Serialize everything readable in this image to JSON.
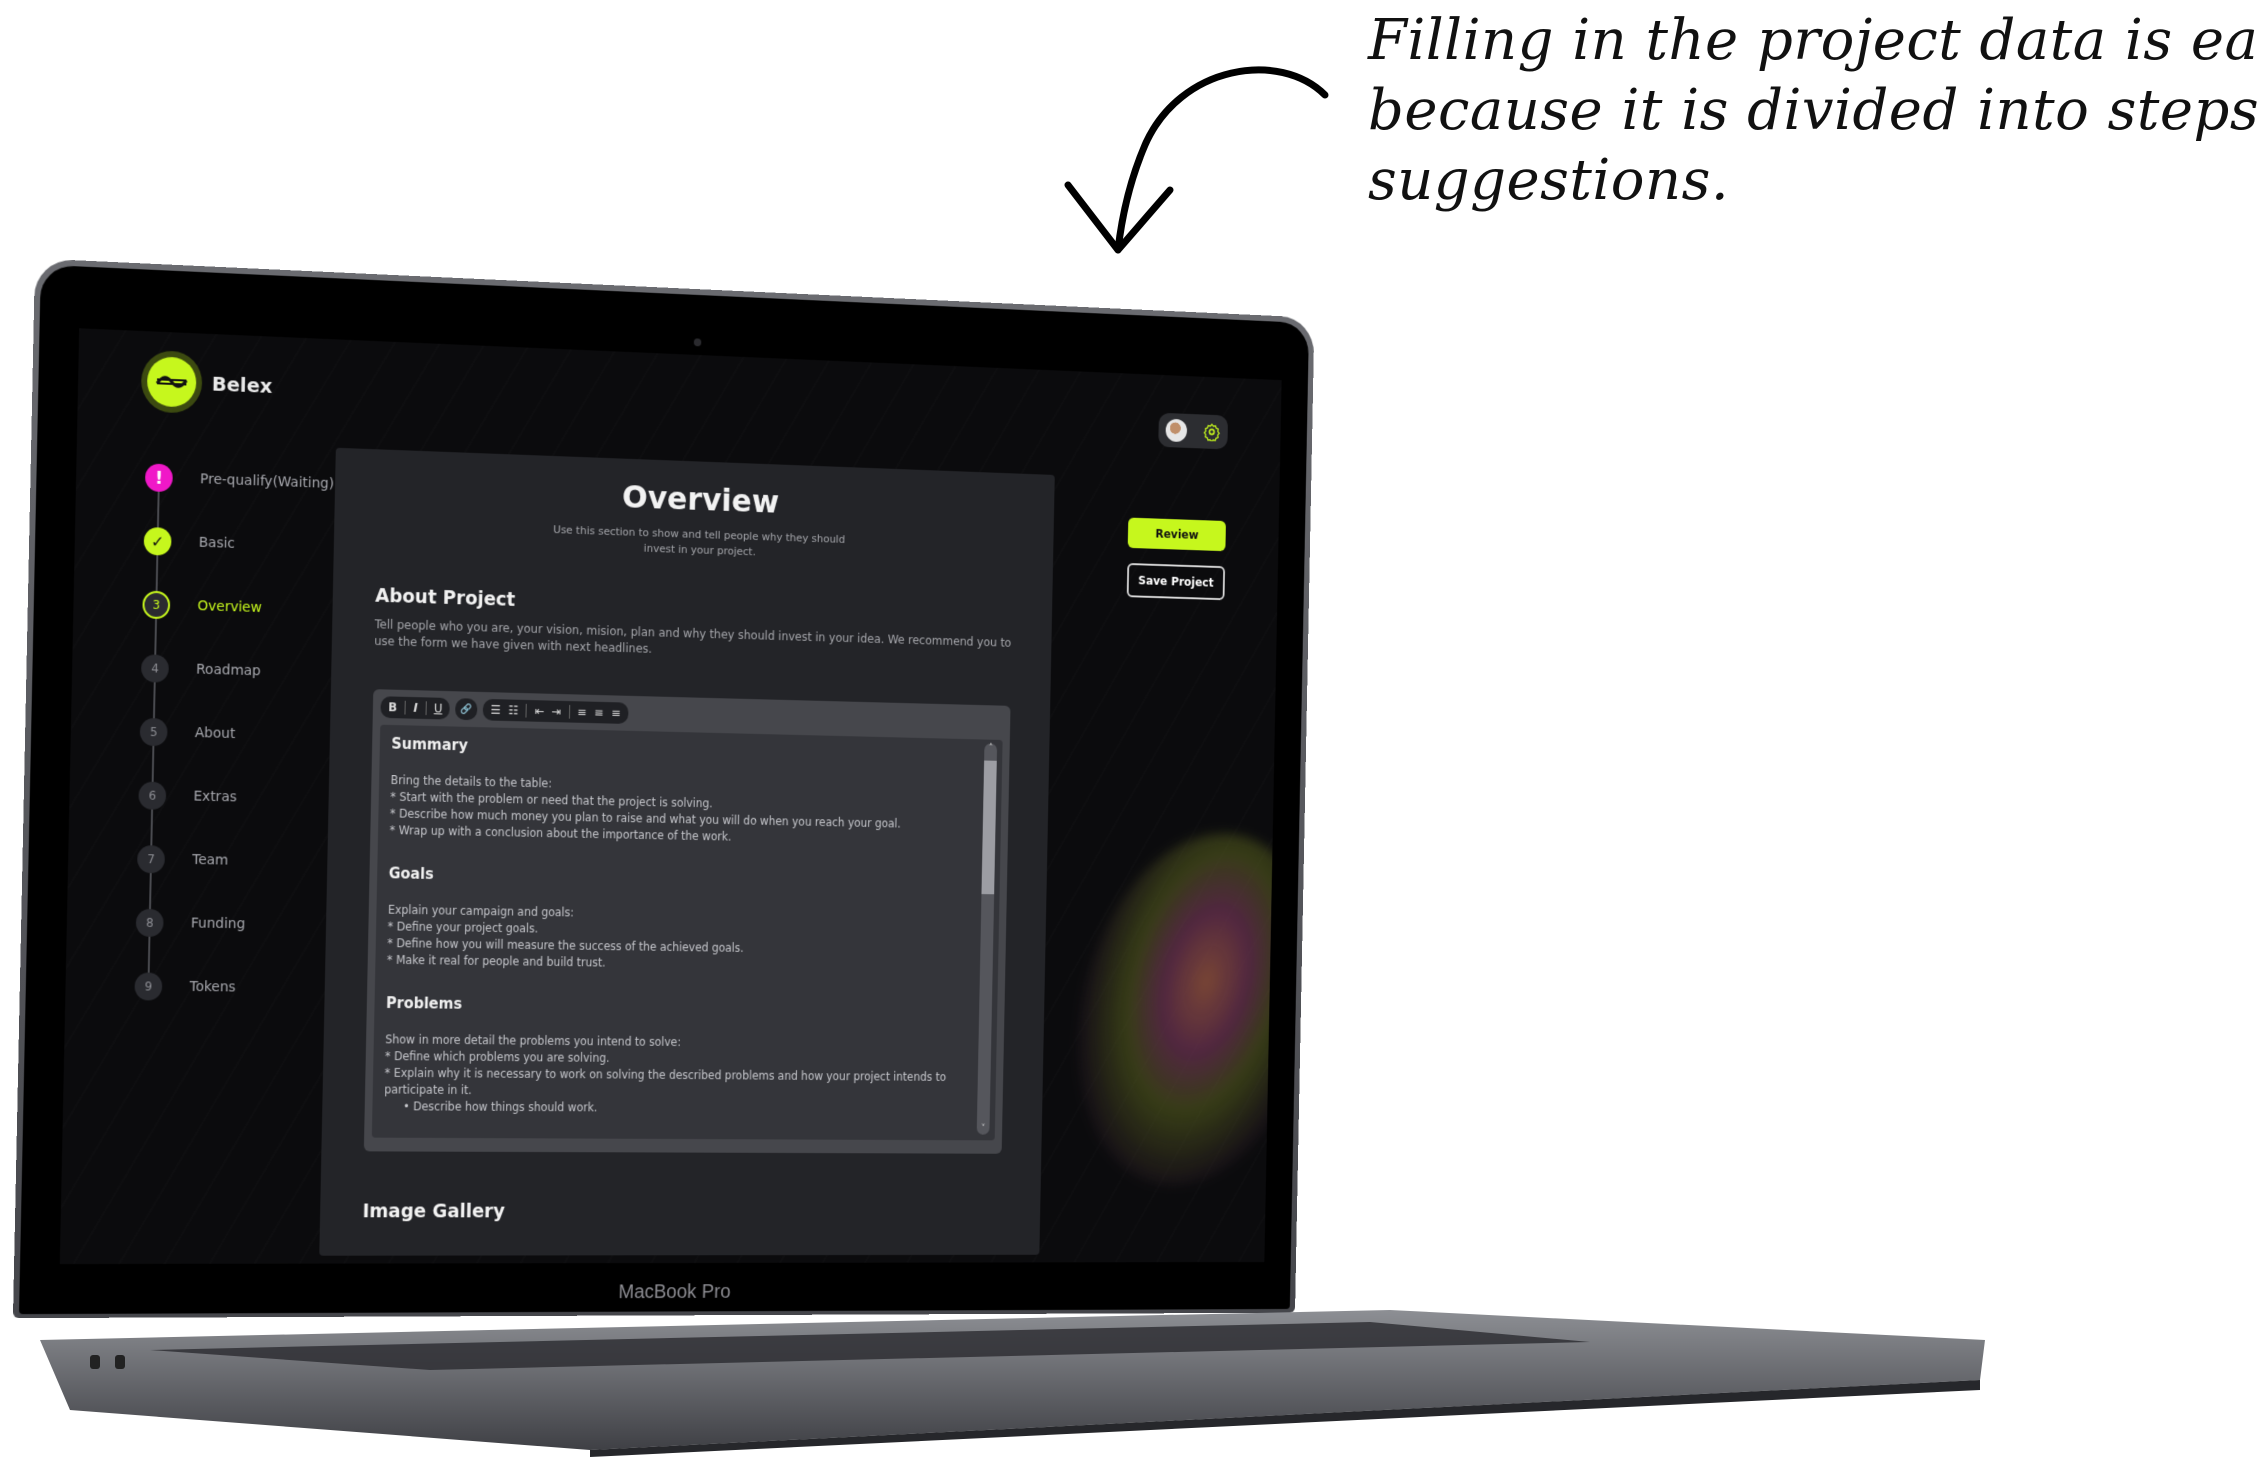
{
  "annotation": {
    "lines": [
      "Filling in the project data is easy",
      "because it is divided into steps with",
      "suggestions."
    ]
  },
  "device": {
    "label": "MacBook Pro"
  },
  "app": {
    "brand": "Belex",
    "accent_color": "#c6f71d",
    "warning_color": "#f018c8"
  },
  "steps": [
    {
      "marker": "!",
      "label": "Pre-qualify(Waiting)",
      "state": "warning"
    },
    {
      "marker": "✓",
      "label": "Basic",
      "state": "done"
    },
    {
      "marker": "3",
      "label": "Overview",
      "state": "active"
    },
    {
      "marker": "4",
      "label": "Roadmap",
      "state": "pending"
    },
    {
      "marker": "5",
      "label": "About",
      "state": "pending"
    },
    {
      "marker": "6",
      "label": "Extras",
      "state": "pending"
    },
    {
      "marker": "7",
      "label": "Team",
      "state": "pending"
    },
    {
      "marker": "8",
      "label": "Funding",
      "state": "pending"
    },
    {
      "marker": "9",
      "label": "Tokens",
      "state": "pending"
    }
  ],
  "actions": {
    "review": "Review",
    "save": "Save Project"
  },
  "main": {
    "title": "Overview",
    "lead": "Use this section to show and tell people why they should invest in your project.",
    "about_title": "About Project",
    "about_desc": "Tell people who you are, your vision, mision, plan and why they should invest in your idea. We recommend you to use the form we have given with next headlines.",
    "toolbar": {
      "bold": "B",
      "italic": "I",
      "underline": "U",
      "link": "🔗",
      "bullets": "☰",
      "numbers": "☷",
      "outdent": "⇤",
      "indent": "⇥",
      "align_left": "≡",
      "align_center": "≡",
      "align_right": "≡"
    },
    "editor": {
      "summary_title": "Summary",
      "summary_lines": [
        "Bring the details to the table:",
        "* Start with the problem or need that the project is solving.",
        "* Describe how much money you plan to raise and what you will do when you reach your goal.",
        "* Wrap up with a conclusion about the importance of the work."
      ],
      "goals_title": "Goals",
      "goals_lines": [
        "Explain your campaign and goals:",
        "* Define your project goals.",
        "* Define how you will measure the success of the achieved goals.",
        "* Make it real for people and build trust."
      ],
      "problems_title": "Problems",
      "problems_lines": [
        "Show in more detail the problems you intend to solve:",
        "* Define which problems you are solving.",
        "* Explain why it is necessary to work on solving the described problems and how your project intends to participate in it."
      ],
      "problems_sub": "•  Describe how things should work.",
      "scroll_position": 0.0
    },
    "gallery_title": "Image Gallery"
  }
}
